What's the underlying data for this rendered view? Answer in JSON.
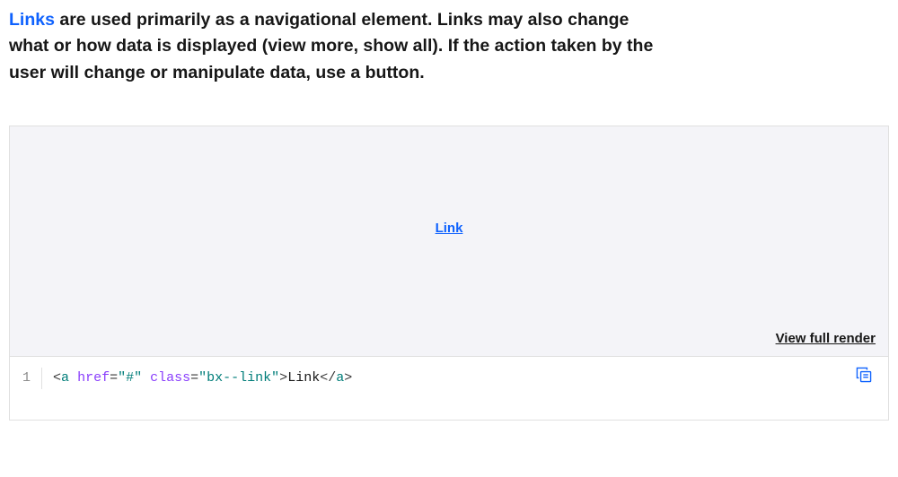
{
  "intro": {
    "link_text": "Links",
    "rest_text": " are used primarily as a navigational element. Links may also change what or how data is displayed (view more, show all). If the action taken by the user will change or manipulate data, use a button."
  },
  "demo": {
    "link_label": "Link"
  },
  "actions": {
    "view_full_render": "View full render"
  },
  "code": {
    "line_number": "1",
    "tokens": {
      "lt1": "<",
      "tag_open": "a",
      "sp1": " ",
      "attr1": "href",
      "eq1": "=",
      "val1": "\"#\"",
      "sp2": " ",
      "attr2": "class",
      "eq2": "=",
      "val2": "\"bx--link\"",
      "gt1": ">",
      "text": "Link",
      "lt2": "</",
      "tag_close": "a",
      "gt2": ">"
    }
  }
}
